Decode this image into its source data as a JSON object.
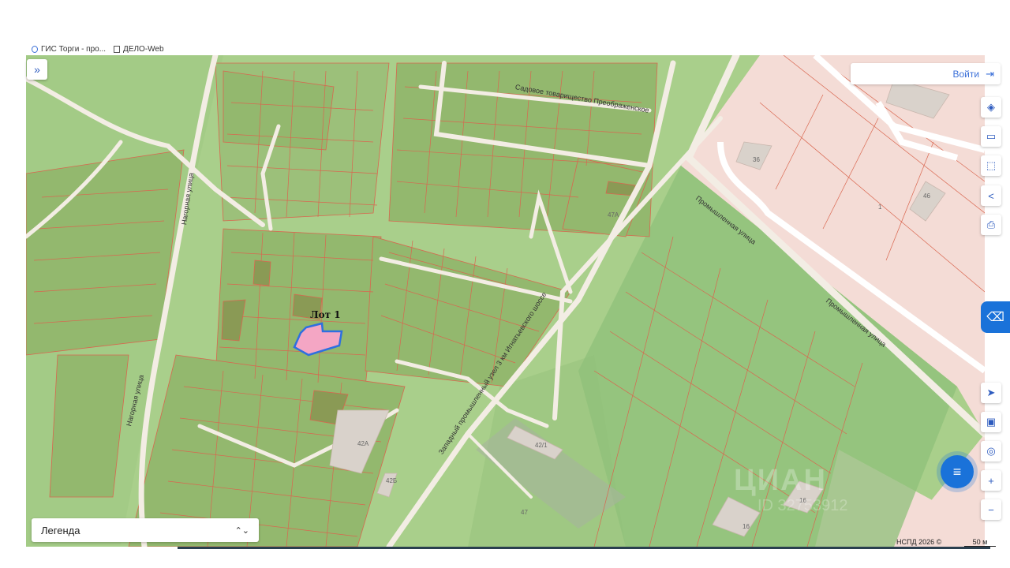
{
  "bookmarks": [
    {
      "icon": "gis-icon",
      "label": "ГИС Торги - про..."
    },
    {
      "icon": "document-icon",
      "label": "ДЕЛО-Web"
    }
  ],
  "map": {
    "lot_label": "Лот 1",
    "street_labels": [
      "Садовое товарищество Преображенское",
      "Нагорная улица",
      "Нагорная улица",
      "Промышленная улица",
      "Промышленная улица",
      "Западный промышленный узел 3 км Игнатьевского шоссе"
    ],
    "building_labels": [
      "42А",
      "42Б",
      "42/1",
      "47",
      "47А",
      "36",
      "46",
      "1",
      "16",
      "16"
    ],
    "colors": {
      "base_green": "#a9cf8b",
      "parcel_fill": "#93b86e",
      "parcel_stroke": "#d9664f",
      "road": "#f3ede4",
      "industrial_zone": "#f4dcd6",
      "lot_fill": "#f4a6c4",
      "lot_stroke": "#2e6fe0",
      "accent": "#1a72d9"
    }
  },
  "controls": {
    "expand_icon": "»",
    "login_label": "Войти",
    "login_icon": "⇥",
    "tools": [
      {
        "name": "layers-icon",
        "glyph": "◈"
      },
      {
        "name": "ruler-icon",
        "glyph": "▭"
      },
      {
        "name": "select-area-icon",
        "glyph": "⬚"
      },
      {
        "name": "share-icon",
        "glyph": "<"
      },
      {
        "name": "print-icon",
        "glyph": "⎙"
      }
    ],
    "map_tools": [
      {
        "name": "navigate-icon",
        "glyph": "➤"
      },
      {
        "name": "minimap-icon",
        "glyph": "▣"
      },
      {
        "name": "location-icon",
        "glyph": "◎"
      },
      {
        "name": "zoom-in-icon",
        "glyph": "+"
      },
      {
        "name": "zoom-out-icon",
        "glyph": "−"
      }
    ],
    "side_tab_icon": "⌫",
    "chat_icon": "≡"
  },
  "legend": {
    "label": "Легенда",
    "chevron": "⌃⌄"
  },
  "footer": {
    "copyright": "НСПД 2026 ©",
    "scale": "50 м"
  },
  "watermark": {
    "text": "ЦИАН",
    "sub": "ID 32753912"
  }
}
